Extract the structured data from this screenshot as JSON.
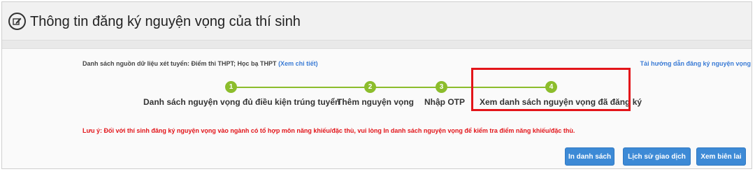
{
  "header": {
    "title": "Thông tin đăng ký nguyện vọng của thí sinh",
    "icon": "edit-icon"
  },
  "source": {
    "label": "Danh sách nguồn dữ liệu xét tuyển: Điểm thi THPT; Học bạ THPT",
    "link": "(Xem chi tiết)"
  },
  "guide_link": "Tải hướng dẫn đăng ký nguyện vọng",
  "steps": [
    {
      "number": "1",
      "label": "Danh sách nguyện vọng đủ điều kiện trúng tuyển"
    },
    {
      "number": "2",
      "label": "Thêm nguyện vọng"
    },
    {
      "number": "3",
      "label": "Nhập OTP"
    },
    {
      "number": "4",
      "label": "Xem danh sách nguyện vọng đã đăng ký"
    }
  ],
  "note": "Lưu ý: Đối với thí sinh đăng ký nguyện vọng vào ngành có tổ hợp môn năng khiếu/đặc thù, vui lòng In danh sách nguyện vọng để kiểm tra điểm năng khiếu/đặc thù.",
  "buttons": {
    "print": "In danh sách",
    "history": "Lịch sử giao dịch",
    "receipt": "Xem biên lai"
  },
  "colors": {
    "step_green": "#8cbd2c",
    "highlight_red": "#e3151a",
    "button_blue": "#3d8ad6",
    "link_blue": "#3a7bd5"
  }
}
